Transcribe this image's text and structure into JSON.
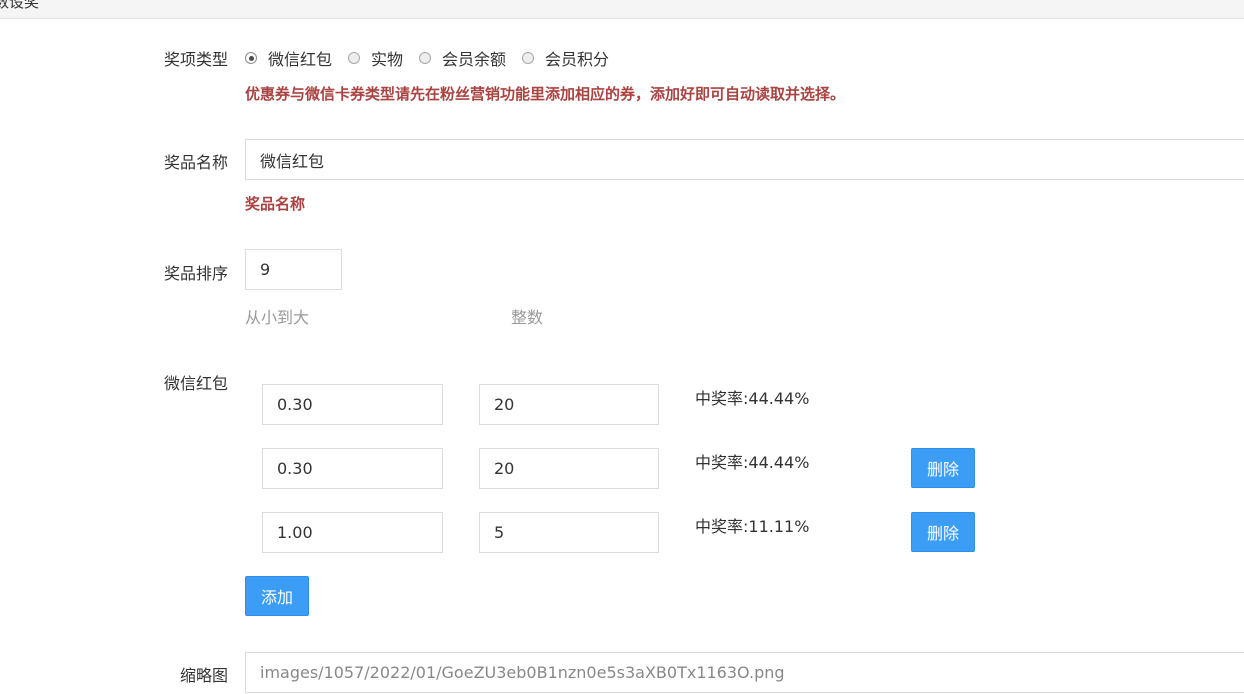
{
  "header": {
    "title": "数设奖"
  },
  "prize_type": {
    "label": "奖项类型",
    "options": [
      {
        "label": "微信红包",
        "checked": true
      },
      {
        "label": "实物",
        "checked": false
      },
      {
        "label": "会员余额",
        "checked": false
      },
      {
        "label": "会员积分",
        "checked": false
      }
    ],
    "warning": "优惠券与微信卡券类型请先在粉丝营销功能里添加相应的券，添加好即可自动读取并选择。"
  },
  "prize_name": {
    "label": "奖品名称",
    "value": "微信红包",
    "hint": "奖品名称"
  },
  "prize_order": {
    "label": "奖品排序",
    "value": "9",
    "hint_order": "从小到大",
    "hint_type": "整数"
  },
  "red_packet": {
    "label": "微信红包",
    "rows": [
      {
        "amount": "0.30",
        "count": "20",
        "rate": "中奖率:44.44%",
        "delete_label": ""
      },
      {
        "amount": "0.30",
        "count": "20",
        "rate": "中奖率:44.44%",
        "delete_label": "删除"
      },
      {
        "amount": "1.00",
        "count": "5",
        "rate": "中奖率:11.11%",
        "delete_label": "删除"
      }
    ],
    "add_label": "添加"
  },
  "thumbnail": {
    "label": "缩略图",
    "value": "images/1057/2022/01/GoeZU3eb0B1nzn0e5s3aXB0Tx1163O.png"
  }
}
